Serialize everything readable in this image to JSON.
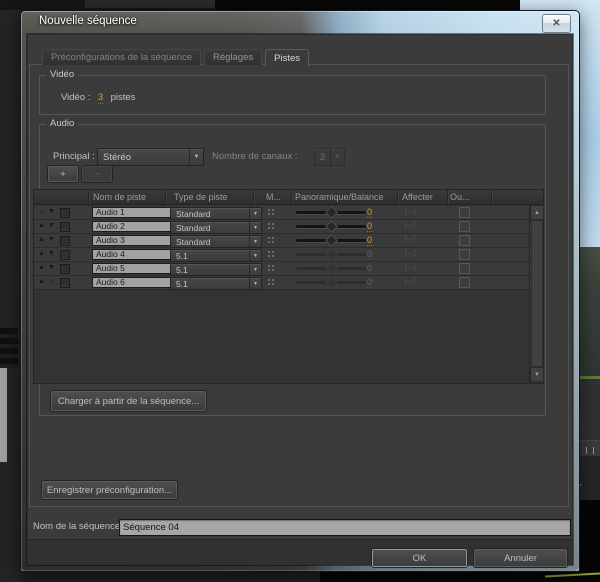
{
  "window": {
    "title": "Nouvelle séquence"
  },
  "tabs": [
    {
      "label": "Préconfigurations de la séquence",
      "active": false
    },
    {
      "label": "Réglages",
      "active": false
    },
    {
      "label": "Pistes",
      "active": true
    }
  ],
  "video": {
    "group_label": "Vidéo",
    "label": "Vidéo :",
    "tracks_value": "3",
    "tracks_suffix": "pistes"
  },
  "audio": {
    "group_label": "Audio",
    "principal_label": "Principal :",
    "principal_value": "Stéréo",
    "channels_label": "Nombre de canaux :",
    "channels_value": "2",
    "add_label": "+",
    "remove_label": "−",
    "table": {
      "headers": [
        "Nom de piste",
        "Type de piste",
        "M...",
        "Panoramique/Balance",
        "Affecter",
        "Ou..."
      ],
      "rows": [
        {
          "name": "Audio 1",
          "type": "Standard",
          "pan": "0"
        },
        {
          "name": "Audio 2",
          "type": "Standard",
          "pan": "0"
        },
        {
          "name": "Audio 3",
          "type": "Standard",
          "pan": "0"
        },
        {
          "name": "Audio 4",
          "type": "5.1",
          "pan": "0"
        },
        {
          "name": "Audio 5",
          "type": "5.1",
          "pan": "0"
        },
        {
          "name": "Audio 6",
          "type": "5.1",
          "pan": "0"
        }
      ]
    },
    "load_button": "Charger à partir de la séquence..."
  },
  "footer": {
    "save_preset_button": "Enregistrer préconfiguration...",
    "sequence_name_label": "Nom de la séquence :",
    "sequence_name_value": "Séquence 04",
    "ok_button": "OK",
    "cancel_button": "Annuler"
  },
  "icons": {
    "close": "✕",
    "dropdown": "▼",
    "up": "▲",
    "down": "▼",
    "scroll_up": "▲",
    "scroll_down": "▼",
    "affect": "|↔|",
    "play": "►"
  },
  "colors": {
    "accent_orange": "#d89e2c",
    "dialog_bg": "#3b3b3b",
    "field_bg": "#a6a6a6",
    "glass_blue": "#b2cfe3"
  }
}
